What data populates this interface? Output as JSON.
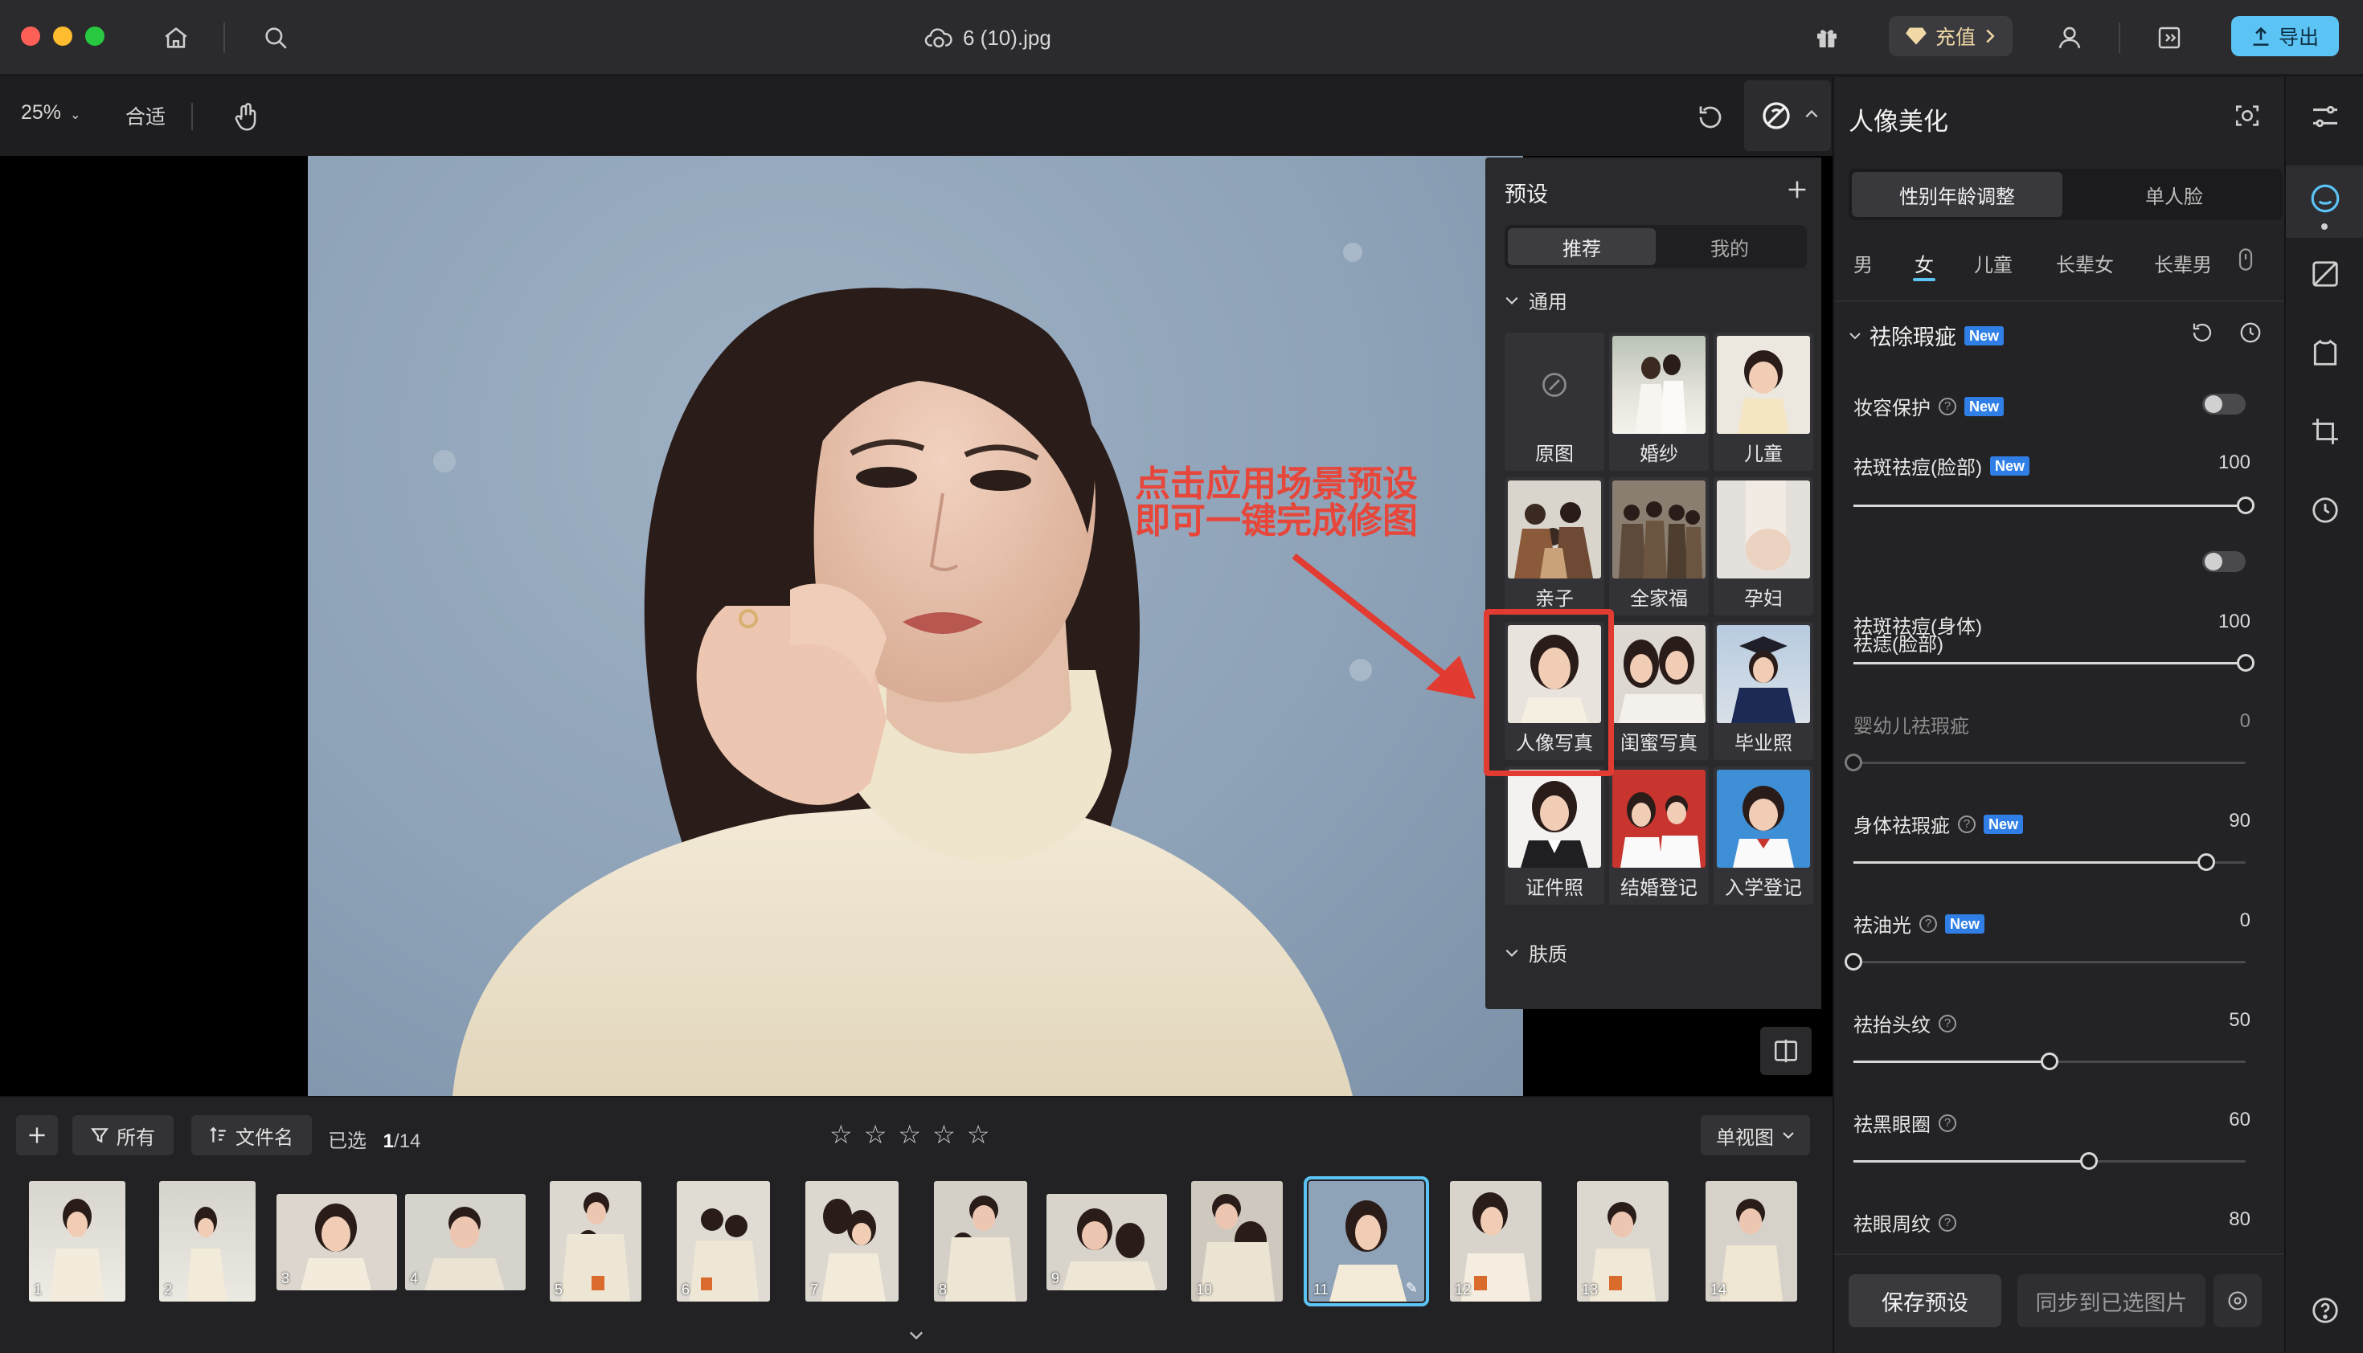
{
  "window": {
    "file_name": "6 (10).jpg",
    "recharge_label": "充值",
    "export_label": "导出"
  },
  "toolbar": {
    "zoom": "25%",
    "fit_label": "合适"
  },
  "annotation": {
    "line1": "点击应用场景预设",
    "line2": "即可一键完成修图"
  },
  "preset_panel": {
    "title": "预设",
    "tabs": [
      "推荐",
      "我的"
    ],
    "section_general": "通用",
    "section_skin": "肤质",
    "presets": [
      "原图",
      "婚纱",
      "儿童",
      "亲子",
      "全家福",
      "孕妇",
      "人像写真",
      "闺蜜写真",
      "毕业照",
      "证件照",
      "结婚登记",
      "入学登记"
    ]
  },
  "right_panel": {
    "title": "人像美化",
    "tabs": [
      "性别年龄调整",
      "单人脸"
    ],
    "categories": [
      "男",
      "女",
      "儿童",
      "长辈女",
      "长辈男"
    ],
    "section_title": "祛除瑕疵",
    "new_badge": "New",
    "makeup_protect": "妆容保护",
    "mole_face": "祛痣(脸部)",
    "adjustments": [
      {
        "label": "祛斑祛痘(脸部)",
        "value": "100",
        "level": 100
      },
      {
        "label": "祛斑祛痘(身体)",
        "value": "100",
        "level": 100
      },
      {
        "label": "婴幼儿祛瑕疵",
        "value": "0",
        "level": 0
      },
      {
        "label": "身体祛瑕疵",
        "value": "90",
        "level": 90
      },
      {
        "label": "祛油光",
        "value": "0",
        "level": 0
      },
      {
        "label": "祛抬头纹",
        "value": "50",
        "level": 50
      },
      {
        "label": "祛黑眼圈",
        "value": "60",
        "level": 60
      },
      {
        "label": "祛眼周纹",
        "value": "80",
        "level": 80
      }
    ],
    "save_preset": "保存预设",
    "sync_selected": "同步到已选图片"
  },
  "filmstrip": {
    "filter_all": "所有",
    "sort_label": "文件名",
    "selected_label": "已选",
    "selected_count": "1",
    "total": "/14",
    "view_mode": "单视图",
    "thumbnails": [
      "1",
      "2",
      "3",
      "4",
      "5",
      "6",
      "7",
      "8",
      "9",
      "10",
      "11",
      "12",
      "13",
      "14"
    ],
    "rating": 0
  },
  "colors": {
    "accent": "#5cc4f5",
    "annotation_red": "#e23b32",
    "new_badge": "#2f7fe6"
  }
}
